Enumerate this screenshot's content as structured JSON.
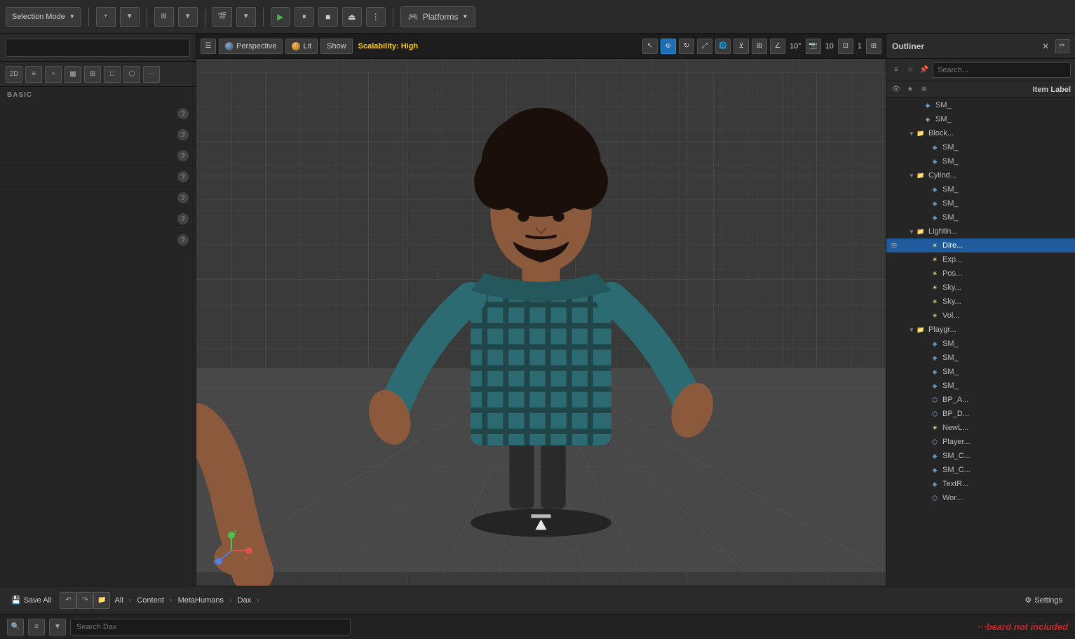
{
  "topToolbar": {
    "selectionMode": "Selection Mode",
    "playLabel": "▶",
    "pauseLabel": "⏸",
    "stopLabel": "■",
    "ejectLabel": "⏏",
    "moreLabel": "⋮",
    "platformsLabel": "Platforms"
  },
  "leftPanel": {
    "sectionLabel": "BASIC",
    "items": [
      {
        "label": "",
        "id": "item1"
      },
      {
        "label": "",
        "id": "item2"
      },
      {
        "label": "",
        "id": "item3"
      },
      {
        "label": "",
        "id": "item4"
      },
      {
        "label": "",
        "id": "item5"
      },
      {
        "label": "",
        "id": "item6"
      },
      {
        "label": "",
        "id": "item7"
      }
    ]
  },
  "viewport": {
    "perspectiveLabel": "Perspective",
    "litLabel": "Lit",
    "showLabel": "Show",
    "scalabilityLabel": "Scalability: High",
    "fovLabel": "10°",
    "fov2Label": "10",
    "gridLabel": "1"
  },
  "outliner": {
    "title": "Outliner",
    "searchPlaceholder": "Search...",
    "columnLabel": "Item Label",
    "items": [
      {
        "label": "SM_",
        "indent": 2,
        "type": "mesh",
        "id": "sm1"
      },
      {
        "label": "SM_",
        "indent": 2,
        "type": "mesh",
        "id": "sm2"
      },
      {
        "label": "Block...",
        "indent": 1,
        "type": "folder",
        "id": "block"
      },
      {
        "label": "SM_",
        "indent": 3,
        "type": "mesh",
        "id": "sm3"
      },
      {
        "label": "SM_",
        "indent": 3,
        "type": "mesh",
        "id": "sm4"
      },
      {
        "label": "Cylind...",
        "indent": 1,
        "type": "folder",
        "id": "cylind"
      },
      {
        "label": "SM_",
        "indent": 3,
        "type": "mesh",
        "id": "sm5"
      },
      {
        "label": "SM_",
        "indent": 3,
        "type": "mesh",
        "id": "sm6"
      },
      {
        "label": "SM_",
        "indent": 3,
        "type": "mesh",
        "id": "sm7"
      },
      {
        "label": "Lightin...",
        "indent": 1,
        "type": "folder",
        "id": "lighting"
      },
      {
        "label": "Dire...",
        "indent": 3,
        "type": "light",
        "id": "directional",
        "selected": true
      },
      {
        "label": "Exp...",
        "indent": 3,
        "type": "light",
        "id": "exponential"
      },
      {
        "label": "Pos...",
        "indent": 3,
        "type": "light",
        "id": "post"
      },
      {
        "label": "Sky...",
        "indent": 3,
        "type": "light",
        "id": "sky1"
      },
      {
        "label": "Sky...",
        "indent": 3,
        "type": "light",
        "id": "sky2"
      },
      {
        "label": "Vol...",
        "indent": 3,
        "type": "light",
        "id": "vol"
      },
      {
        "label": "Playgr...",
        "indent": 1,
        "type": "folder",
        "id": "playground"
      },
      {
        "label": "SM_",
        "indent": 3,
        "type": "mesh",
        "id": "sm8"
      },
      {
        "label": "SM_",
        "indent": 3,
        "type": "mesh",
        "id": "sm9"
      },
      {
        "label": "SM_",
        "indent": 3,
        "type": "mesh",
        "id": "sm10"
      },
      {
        "label": "SM_",
        "indent": 3,
        "type": "mesh",
        "id": "sm11"
      },
      {
        "label": "BP_A...",
        "indent": 3,
        "type": "bp",
        "id": "bp1"
      },
      {
        "label": "BP_D...",
        "indent": 3,
        "type": "bp",
        "id": "bp2"
      },
      {
        "label": "NewL...",
        "indent": 3,
        "type": "light",
        "id": "newl"
      },
      {
        "label": "Player...",
        "indent": 3,
        "type": "bp",
        "id": "player"
      },
      {
        "label": "SM_C...",
        "indent": 3,
        "type": "mesh",
        "id": "smc1"
      },
      {
        "label": "SM_C...",
        "indent": 3,
        "type": "mesh",
        "id": "smc2"
      },
      {
        "label": "TextR...",
        "indent": 3,
        "type": "mesh",
        "id": "textr"
      },
      {
        "label": "Wor...",
        "indent": 3,
        "type": "bp",
        "id": "world"
      }
    ]
  },
  "bottomBar": {
    "saveAll": "Save All",
    "breadcrumbs": [
      "All",
      "Content",
      "MetaHumans",
      "Dax"
    ],
    "settings": "Settings"
  },
  "veryBottom": {
    "searchPlaceholder": "Search Dax"
  },
  "watermark": "···beard not included"
}
